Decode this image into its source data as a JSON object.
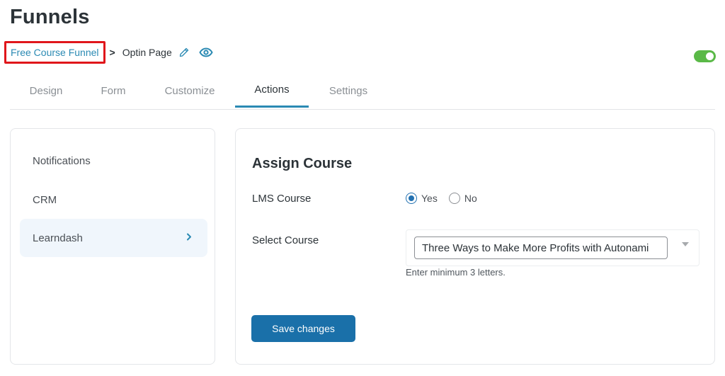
{
  "page": {
    "title": "Funnels"
  },
  "breadcrumb": {
    "parent": "Free Course Funnel",
    "separator": ">",
    "current": "Optin Page",
    "icons": [
      "pencil-icon",
      "eye-icon"
    ]
  },
  "status_toggle": {
    "enabled": true,
    "color": "#5ab947"
  },
  "tabs": [
    {
      "label": "Design",
      "active": false
    },
    {
      "label": "Form",
      "active": false
    },
    {
      "label": "Customize",
      "active": false
    },
    {
      "label": "Actions",
      "active": true
    },
    {
      "label": "Settings",
      "active": false
    }
  ],
  "sidebar": {
    "items": [
      {
        "label": "Notifications",
        "active": false
      },
      {
        "label": "CRM",
        "active": false
      },
      {
        "label": "Learndash",
        "active": true,
        "icon": "chevron-right-icon"
      }
    ]
  },
  "panel": {
    "title": "Assign Course",
    "lms_course": {
      "label": "LMS Course",
      "options": [
        {
          "label": "Yes",
          "checked": true
        },
        {
          "label": "No",
          "checked": false
        }
      ]
    },
    "select_course": {
      "label": "Select Course",
      "value": "Three Ways to Make More Profits with Autonami",
      "hint": "Enter minimum 3 letters."
    },
    "save_label": "Save changes"
  },
  "colors": {
    "accent": "#2b8ab3",
    "primary_button": "#1a70a9",
    "highlight_box": "#e0161b",
    "toggle_on": "#5ab947"
  }
}
